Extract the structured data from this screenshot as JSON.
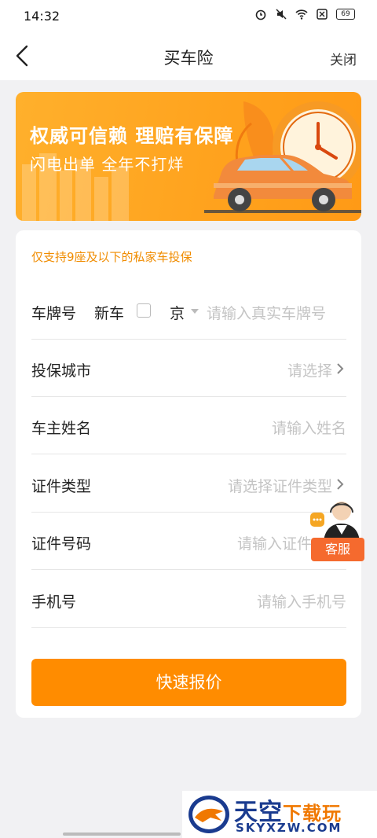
{
  "status_bar": {
    "time": "14:32",
    "battery": "69"
  },
  "nav": {
    "title": "买车险",
    "close_label": "关闭"
  },
  "banner": {
    "headline": "权威可信赖  理赔有保障",
    "subline": "闪电出单  全年不打烊"
  },
  "form": {
    "notice": "仅支持9座及以下的私家车投保",
    "plate": {
      "label": "车牌号",
      "new_car_label": "新车",
      "province": "京",
      "placeholder": "请输入真实车牌号"
    },
    "city": {
      "label": "投保城市",
      "placeholder": "请选择"
    },
    "owner": {
      "label": "车主姓名",
      "placeholder": "请输入姓名"
    },
    "id_type": {
      "label": "证件类型",
      "placeholder": "请选择证件类型"
    },
    "id_number": {
      "label": "证件号码",
      "placeholder": "请输入证件"
    },
    "phone": {
      "label": "手机号",
      "placeholder": "请输入手机号"
    },
    "submit_label": "快速报价"
  },
  "customer_service": {
    "label": "客服"
  },
  "watermark": {
    "title_a": "天空",
    "title_b": "下载玩",
    "url": "SKYXZW.COM"
  },
  "colors": {
    "accent": "#ff8c00",
    "notice": "#f08c00",
    "cs_tag": "#f56a2e"
  }
}
